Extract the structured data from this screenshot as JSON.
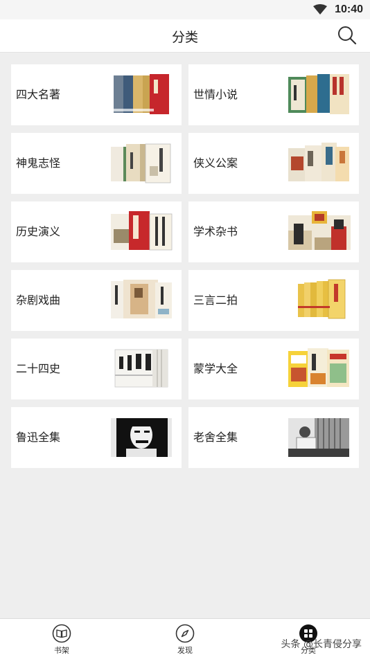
{
  "status_bar": {
    "time": "10:40",
    "wifi_icon": "wifi-icon"
  },
  "header": {
    "title": "分类",
    "search_icon": "search-icon"
  },
  "categories": [
    {
      "label": "四大名著",
      "thumbnail": "book-set-thumbnail"
    },
    {
      "label": "世情小说",
      "thumbnail": "book-set-thumbnail"
    },
    {
      "label": "神鬼志怪",
      "thumbnail": "book-set-thumbnail"
    },
    {
      "label": "侠义公案",
      "thumbnail": "book-set-thumbnail"
    },
    {
      "label": "历史演义",
      "thumbnail": "book-set-thumbnail"
    },
    {
      "label": "学术杂书",
      "thumbnail": "book-set-thumbnail"
    },
    {
      "label": "杂剧戏曲",
      "thumbnail": "book-set-thumbnail"
    },
    {
      "label": "三言二拍",
      "thumbnail": "book-set-thumbnail"
    },
    {
      "label": "二十四史",
      "thumbnail": "book-set-thumbnail"
    },
    {
      "label": "蒙学大全",
      "thumbnail": "book-set-thumbnail"
    },
    {
      "label": "鲁迅全集",
      "thumbnail": "portrait-woodcut-thumbnail"
    },
    {
      "label": "老舍全集",
      "thumbnail": "portrait-photo-thumbnail"
    }
  ],
  "tabbar": {
    "tabs": [
      {
        "label": "书架",
        "icon": "book-open-icon",
        "active": false
      },
      {
        "label": "发现",
        "icon": "compass-icon",
        "active": false
      },
      {
        "label": "分类",
        "icon": "grid-icon",
        "active": true
      }
    ]
  },
  "watermark": "头条 @长青侵分享",
  "colors": {
    "background": "#eeeeee",
    "card": "#ffffff",
    "text": "#222222"
  }
}
